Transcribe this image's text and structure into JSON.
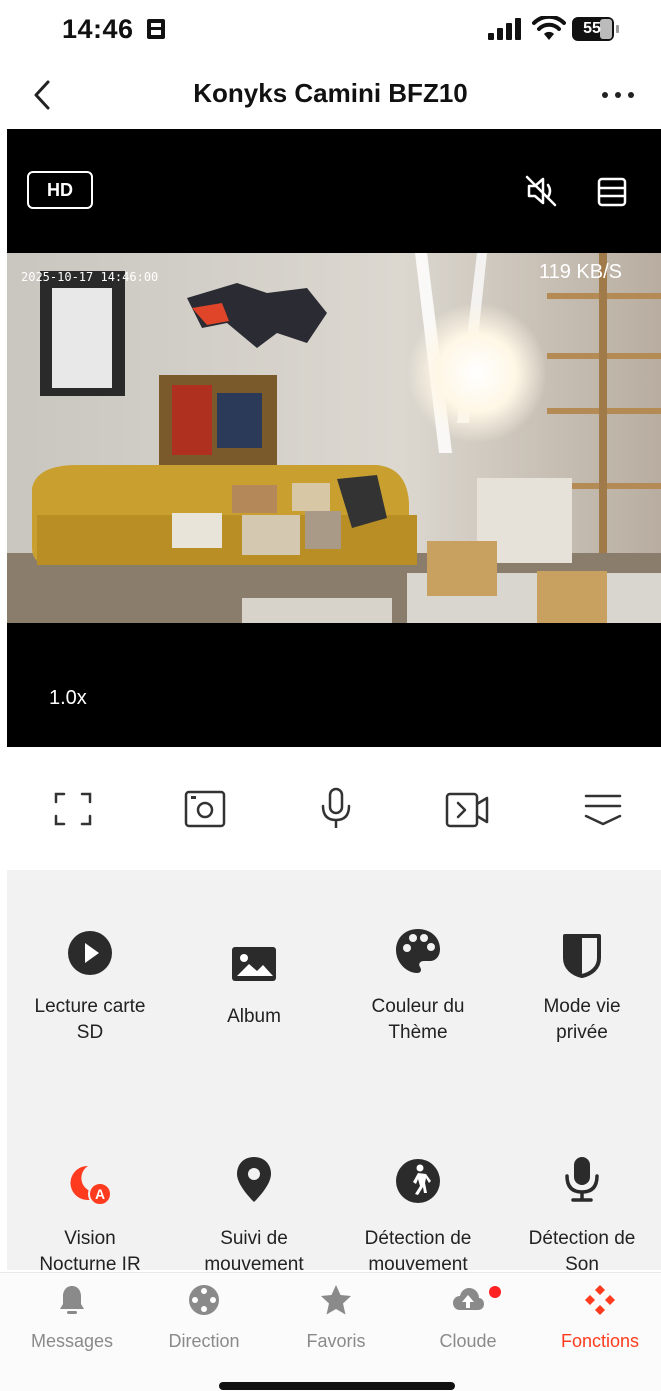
{
  "status_bar": {
    "time": "14:46",
    "battery": "55"
  },
  "header": {
    "title": "Konyks Camini BFZ10"
  },
  "video": {
    "quality_label": "HD",
    "timestamp": "2025-10-17  14:46:00",
    "bitrate": "119 KB/S",
    "zoom": "1.0x",
    "muted": true
  },
  "controls": [
    {
      "icon": "fullscreen-icon"
    },
    {
      "icon": "screenshot-icon"
    },
    {
      "icon": "microphone-icon"
    },
    {
      "icon": "record-video-icon"
    },
    {
      "icon": "collapse-icon"
    }
  ],
  "functions": [
    {
      "label": "Lecture carte SD",
      "icon": "play-circle-icon"
    },
    {
      "label": "Album",
      "icon": "image-icon"
    },
    {
      "label": "Couleur du Thème",
      "icon": "palette-icon"
    },
    {
      "label": "Mode vie privée",
      "icon": "privacy-shield-icon"
    },
    {
      "label": "Vision Nocturne IR",
      "icon": "night-vision-icon",
      "color": "#ff3b1f"
    },
    {
      "label": "Suivi de mouvement",
      "icon": "location-pin-icon"
    },
    {
      "label": "Détection de mouvement",
      "icon": "walking-person-icon"
    },
    {
      "label": "Détection de Son",
      "icon": "sound-detection-icon"
    }
  ],
  "tabs": [
    {
      "label": "Messages",
      "icon": "bell-icon"
    },
    {
      "label": "Direction",
      "icon": "direction-pad-icon"
    },
    {
      "label": "Favoris",
      "icon": "star-icon"
    },
    {
      "label": "Cloude",
      "icon": "cloud-upload-icon",
      "badge": true
    },
    {
      "label": "Fonctions",
      "icon": "functions-icon",
      "active": true
    }
  ],
  "colors": {
    "accent": "#ff3b1f",
    "icon_dark": "#2b2b2b",
    "panel_bg": "#f2f2f2"
  }
}
